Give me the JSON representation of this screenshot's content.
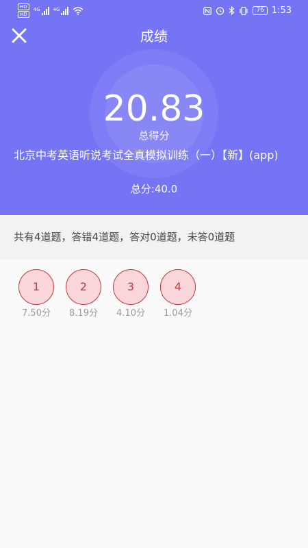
{
  "status_bar": {
    "hd_badges": [
      "HD",
      "HD"
    ],
    "signal_labels": [
      "4G",
      "4G"
    ],
    "icons": [
      "hd-icon",
      "signal-icon",
      "signal-icon",
      "wifi-icon",
      "nfc-icon",
      "alarm-icon",
      "bluetooth-icon",
      "vibrate-icon",
      "battery-icon"
    ],
    "battery": "76",
    "time": "1:53"
  },
  "nav": {
    "close_icon": "close-icon",
    "title": "成绩"
  },
  "score": {
    "value": "20.83",
    "label": "总得分"
  },
  "exam": {
    "title": "北京中考英语听说考试全真模拟训练（一）【新】(app)",
    "total": "总分:40.0"
  },
  "summary": {
    "text": "共有4道题，答错4道题，答对0道题，未答0道题"
  },
  "questions": [
    {
      "number": "1",
      "score": "7.50分"
    },
    {
      "number": "2",
      "score": "8.19分"
    },
    {
      "number": "3",
      "score": "4.10分"
    },
    {
      "number": "4",
      "score": "1.04分"
    }
  ],
  "colors": {
    "header_bg": "#7574f5",
    "wrong_fill": "#f9d6d9",
    "wrong_border": "#c9343e",
    "summary_bg": "#f2f2f2",
    "page_bg": "#fafafa"
  }
}
